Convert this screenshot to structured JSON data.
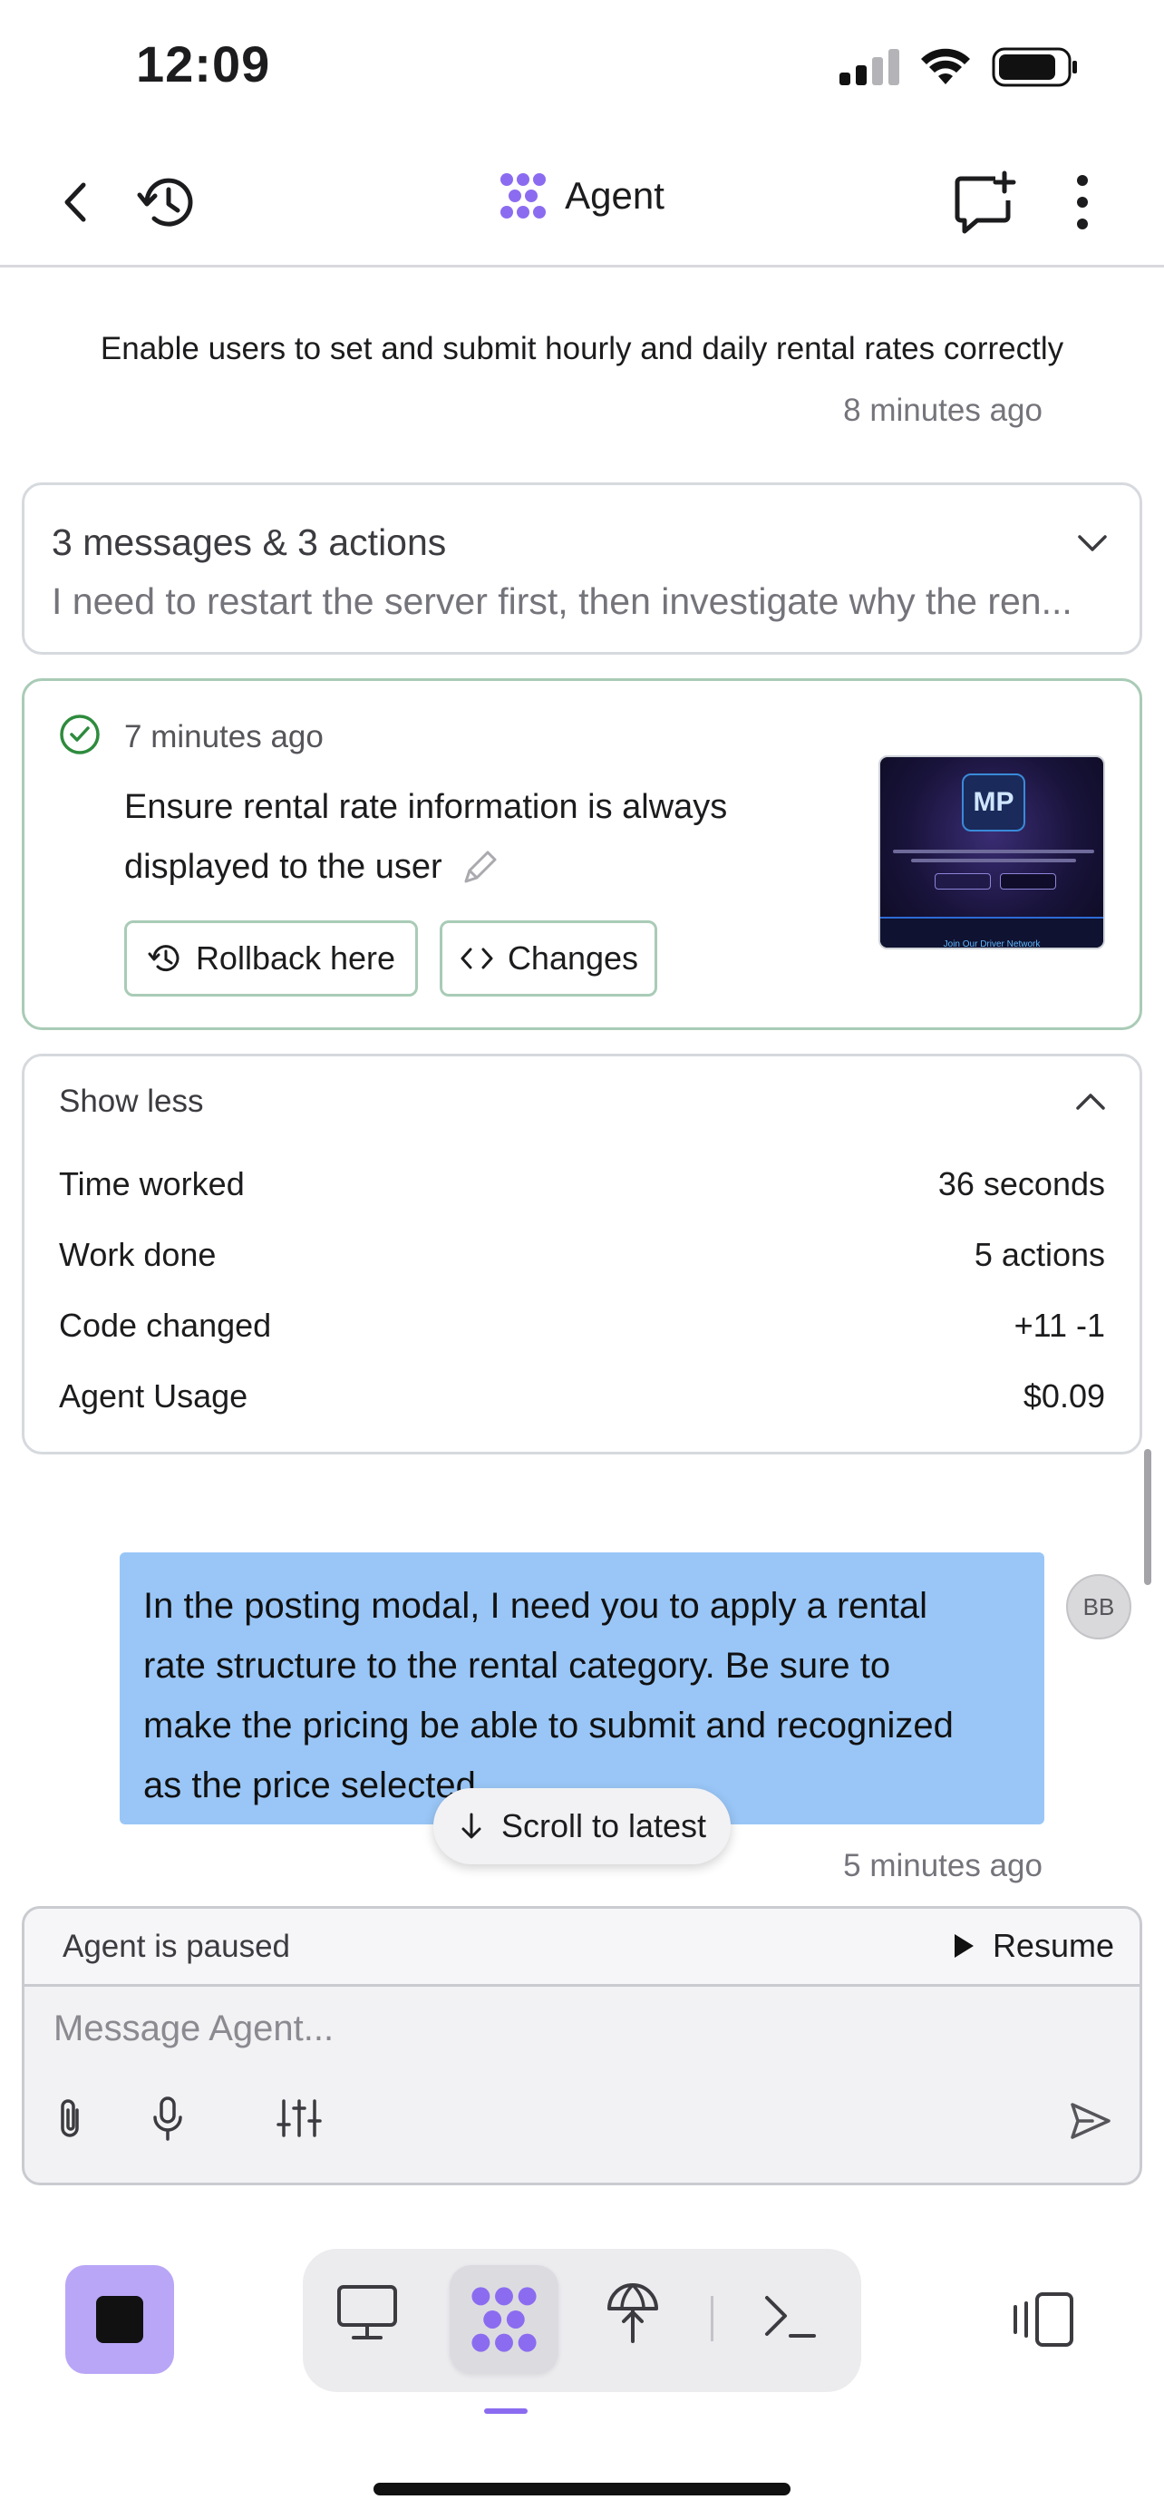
{
  "status_bar": {
    "time": "12:09"
  },
  "header": {
    "title": "Agent"
  },
  "goal": {
    "text": "Enable users to set and submit hourly and daily rental rates correctly",
    "timestamp": "8 minutes ago"
  },
  "collapsed": {
    "title": "3 messages & 3 actions",
    "subtitle": "I need to restart the server first, then investigate why the ren..."
  },
  "checkpoint": {
    "timestamp": "7 minutes ago",
    "line1": "Ensure rental rate information is always",
    "line2": "displayed to the user",
    "rollback_label": "Rollback here",
    "changes_label": "Changes",
    "preview": {
      "logo": "MP",
      "text": "Join Our Driver Network"
    }
  },
  "stats": {
    "toggle_label": "Show less",
    "rows": [
      {
        "label": "Time worked",
        "value": "36 seconds"
      },
      {
        "label": "Work done",
        "value": "5 actions"
      },
      {
        "label": "Code changed",
        "value": "+11 -1"
      },
      {
        "label": "Agent Usage",
        "value": "$0.09"
      }
    ]
  },
  "user_message": {
    "line1": "In the posting modal, I need you to apply a rental",
    "line2": "rate structure to the rental category. Be sure to",
    "line3": "make the pricing be able to submit and recognized",
    "line4": "as the price selected",
    "avatar": "BB",
    "timestamp": "5 minutes ago"
  },
  "scroll_pill": {
    "label": "Scroll to latest"
  },
  "composer": {
    "paused_text": "Agent is paused",
    "resume_label": "Resume",
    "placeholder": "Message Agent..."
  },
  "colors": {
    "accent": "#8b6cf0",
    "stop_button": "#b9a6f7",
    "user_bubble": "#99c6f7",
    "success": "#2e8b3d"
  }
}
